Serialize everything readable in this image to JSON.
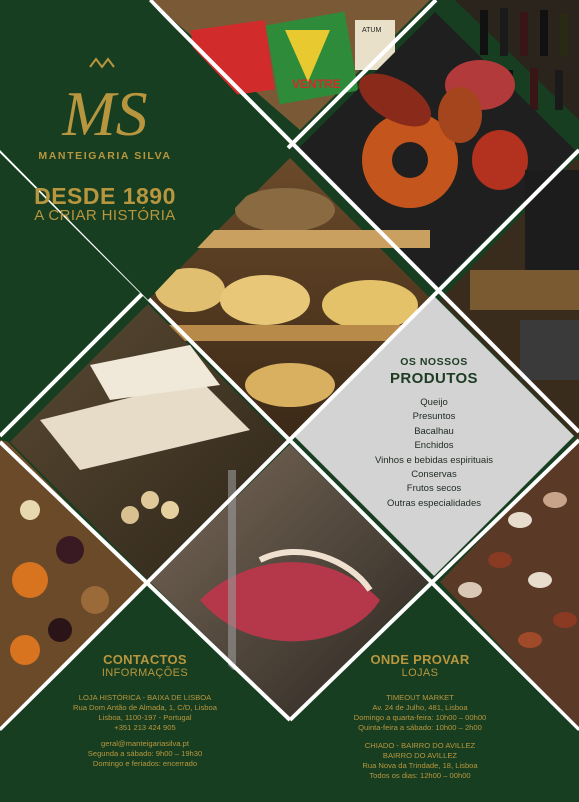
{
  "brand": {
    "monogram": "MS",
    "name": "MANTEIGARIA SILVA",
    "since": "DESDE 1890",
    "tagline": "A CRIAR HISTÓRIA"
  },
  "photo_labels": {
    "tins": [
      "VENTRE",
      "ATUM"
    ]
  },
  "products": {
    "kicker": "OS NOSSOS",
    "title": "PRODUTOS",
    "items": [
      "Queijo",
      "Presuntos",
      "Bacalhau",
      "Enchidos",
      "Vinhos e bebidas espirituais",
      "Conservas",
      "Frutos secos",
      "Outras especialidades"
    ]
  },
  "contacts": {
    "title": "CONTACTOS",
    "subtitle": "INFORMAÇÕES",
    "lines": [
      "LOJA HISTÓRICA - BAIXA DE LISBOA",
      "Rua Dom Antão de Almada, 1, C/D, Lisboa",
      "Lisboa, 1100-197 - Portugal",
      "+351 213 424 905",
      "geral@manteigariasilva.pt",
      "Segunda a sábado: 9h00 – 19h30",
      "Domingo e feriados: encerrado"
    ]
  },
  "shops": {
    "title": "ONDE PROVAR",
    "subtitle": "LOJAS",
    "lines": [
      "TIMEOUT MARKET",
      "Av. 24 de Julho, 481, Lisboa",
      "Domingo a quarta-feira: 10h00 – 00h00",
      "Quinta-feira a sábado: 10h00 – 2h00",
      "CHIADO - BAIRRO DO AVILLEZ",
      "BAIRRO DO AVILLEZ",
      "Rua Nova da Trindade, 18, Lisboa",
      "Todos os dias: 12h00 – 00h00"
    ]
  },
  "colors": {
    "background": "#173e20",
    "gold": "#b8963f",
    "products_panel": "#d3d3d3"
  }
}
